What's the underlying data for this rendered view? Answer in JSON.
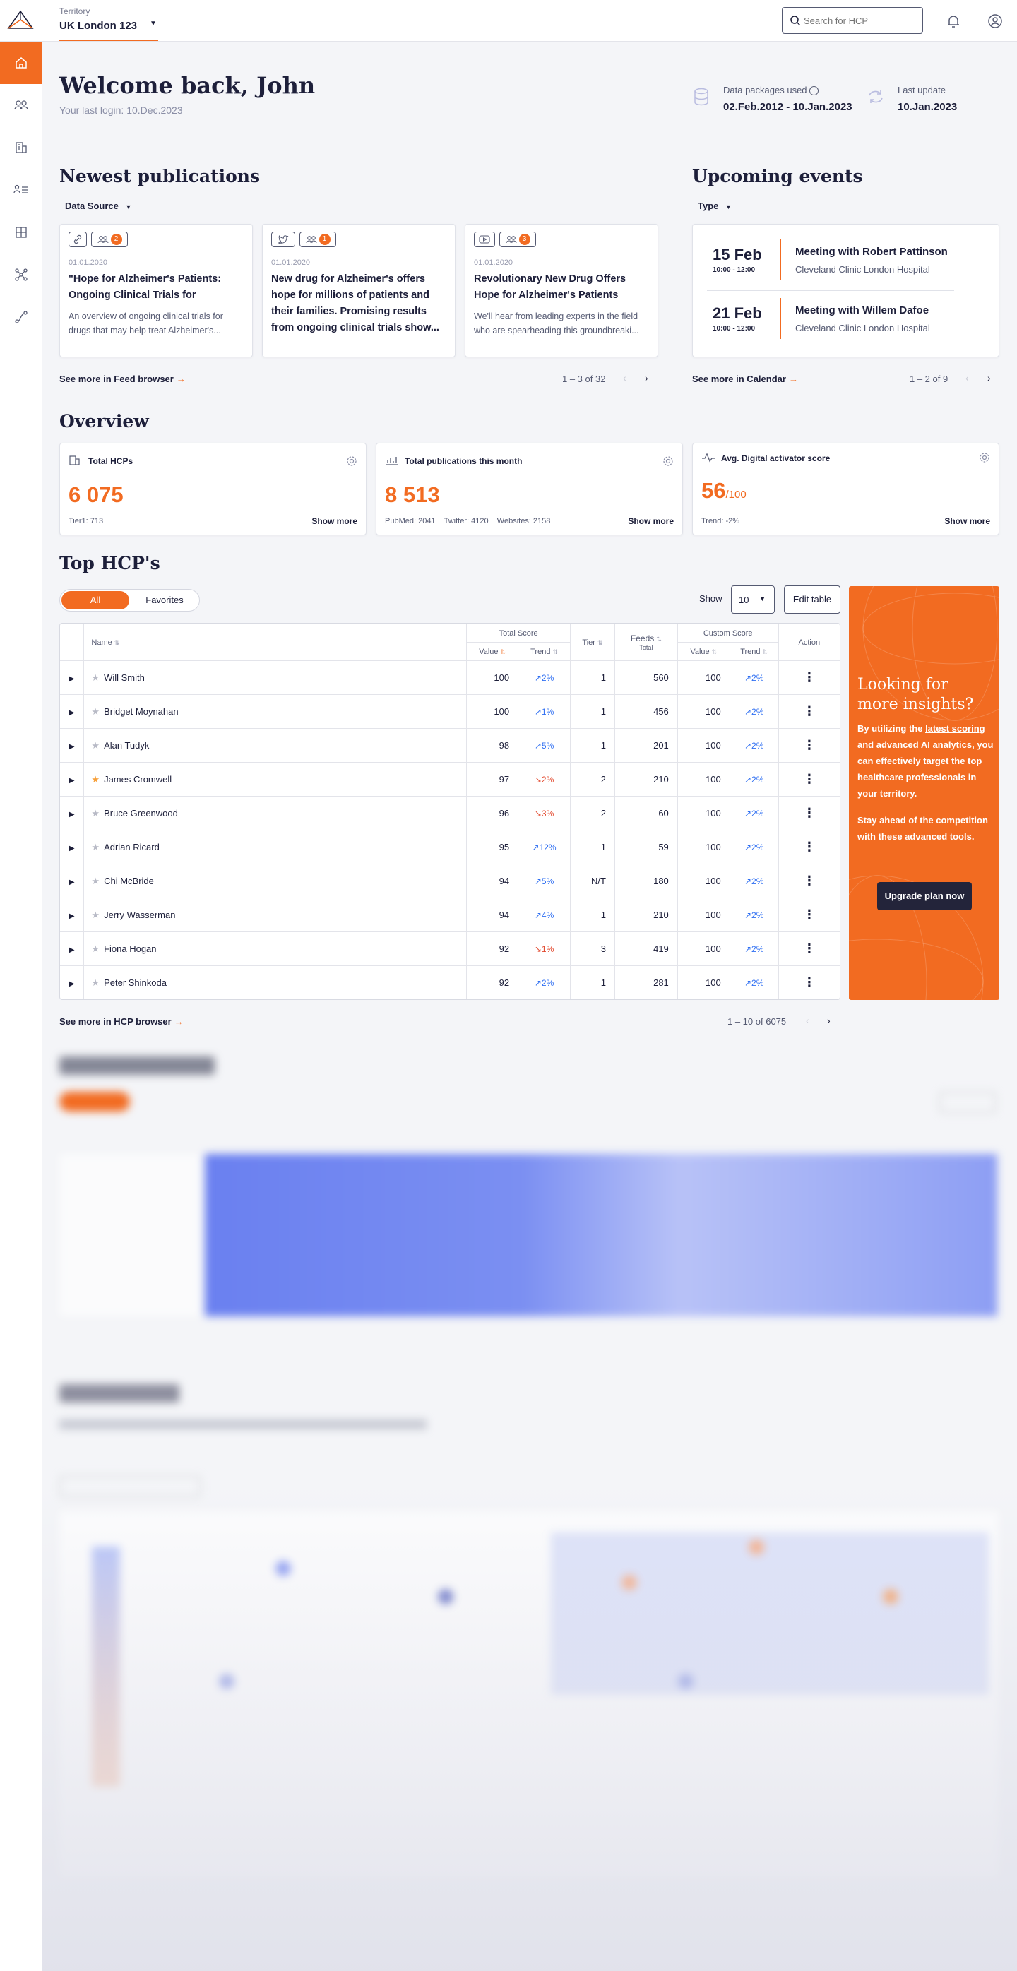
{
  "header": {
    "territory_label": "Territory",
    "territory_value": "UK London 123",
    "search_placeholder": "Search for HCP"
  },
  "welcome": {
    "title": "Welcome back, John",
    "last_login": "Your last login: 10.Dec.2023",
    "packages_label": "Data packages used",
    "packages_value": "02.Feb.2012 - 10.Jan.2023",
    "update_label": "Last update",
    "update_value": "10.Jan.2023"
  },
  "publications": {
    "title": "Newest publications",
    "filter": "Data Source",
    "items": [
      {
        "date": "01.01.2020",
        "count": "2",
        "title": "\"Hope for Alzheimer's Patients: Ongoing Clinical Trials for Promising...",
        "body": "An overview of ongoing clinical trials for drugs that may help treat Alzheimer's..."
      },
      {
        "date": "01.01.2020",
        "count": "1",
        "title": "New drug for Alzheimer's offers hope for millions of patients and their families. Promising results from ongoing clinical trials show...",
        "body": ""
      },
      {
        "date": "01.01.2020",
        "count": "3",
        "title": "Revolutionary New Drug Offers Hope for Alzheimer's Patients",
        "body": "We'll hear from leading experts in the field who are spearheading this groundbreaki..."
      }
    ],
    "see_more": "See more in Feed browser",
    "pager": "1 – 3 of 32"
  },
  "events": {
    "title": "Upcoming events",
    "filter": "Type",
    "items": [
      {
        "date": "15 Feb",
        "time": "10:00 - 12:00",
        "title": "Meeting with Robert Pattinson",
        "location": "Cleveland Clinic London Hospital"
      },
      {
        "date": "21 Feb",
        "time": "10:00 - 12:00",
        "title": "Meeting with Willem Dafoe",
        "location": "Cleveland Clinic London Hospital"
      }
    ],
    "see_more": "See more in Calendar",
    "pager": "1 – 2 of 9"
  },
  "overview": {
    "title": "Overview",
    "cards": [
      {
        "title": "Total HCPs",
        "value": "6 075",
        "unit": "",
        "detail": "Tier1: 713",
        "more": "Show more"
      },
      {
        "title": "Total publications this month",
        "value": "8 513",
        "unit": "",
        "detail": "PubMed: 2041    Twitter: 4120    Websites: 2158",
        "more": "Show more"
      },
      {
        "title": "Avg. Digital activator score",
        "value": "56",
        "unit": "/100",
        "detail": "Trend: -2%",
        "more": "Show more"
      }
    ]
  },
  "top_hcps": {
    "title": "Top HCP's",
    "tab_all": "All",
    "tab_favorites": "Favorites",
    "show_label": "Show",
    "show_value": "10",
    "edit_table": "Edit table",
    "columns": {
      "name": "Name",
      "total_score": "Total Score",
      "value": "Value",
      "trend": "Trend",
      "tier": "Tier",
      "feeds": "Feeds",
      "feeds_sub": "Total",
      "custom_score": "Custom Score",
      "action": "Action"
    },
    "rows": [
      {
        "name": "Will Smith",
        "fav": false,
        "value": "100",
        "trend": "2%",
        "dir": "up",
        "tier": "1",
        "feeds": "560",
        "cvalue": "100",
        "ctrend": "2%"
      },
      {
        "name": "Bridget Moynahan",
        "fav": false,
        "value": "100",
        "trend": "1%",
        "dir": "up",
        "tier": "1",
        "feeds": "456",
        "cvalue": "100",
        "ctrend": "2%"
      },
      {
        "name": "Alan Tudyk",
        "fav": false,
        "value": "98",
        "trend": "5%",
        "dir": "up",
        "tier": "1",
        "feeds": "201",
        "cvalue": "100",
        "ctrend": "2%"
      },
      {
        "name": "James Cromwell",
        "fav": true,
        "value": "97",
        "trend": "2%",
        "dir": "down",
        "tier": "2",
        "feeds": "210",
        "cvalue": "100",
        "ctrend": "2%"
      },
      {
        "name": "Bruce Greenwood",
        "fav": false,
        "value": "96",
        "trend": "3%",
        "dir": "down",
        "tier": "2",
        "feeds": "60",
        "cvalue": "100",
        "ctrend": "2%"
      },
      {
        "name": "Adrian Ricard",
        "fav": false,
        "value": "95",
        "trend": "12%",
        "dir": "up",
        "tier": "1",
        "feeds": "59",
        "cvalue": "100",
        "ctrend": "2%"
      },
      {
        "name": "Chi McBride",
        "fav": false,
        "value": "94",
        "trend": "5%",
        "dir": "up",
        "tier": "N/T",
        "feeds": "180",
        "cvalue": "100",
        "ctrend": "2%"
      },
      {
        "name": "Jerry Wasserman",
        "fav": false,
        "value": "94",
        "trend": "4%",
        "dir": "up",
        "tier": "1",
        "feeds": "210",
        "cvalue": "100",
        "ctrend": "2%"
      },
      {
        "name": "Fiona Hogan",
        "fav": false,
        "value": "92",
        "trend": "1%",
        "dir": "down",
        "tier": "3",
        "feeds": "419",
        "cvalue": "100",
        "ctrend": "2%"
      },
      {
        "name": "Peter Shinkoda",
        "fav": false,
        "value": "92",
        "trend": "2%",
        "dir": "up",
        "tier": "1",
        "feeds": "281",
        "cvalue": "100",
        "ctrend": "2%"
      }
    ],
    "see_more": "See more in HCP browser",
    "pager": "1 – 10 of 6075"
  },
  "promo": {
    "title": "Looking for more insights?",
    "p1_pre": "By utilizing the ",
    "p1_link": "latest scoring and advanced AI analytics,",
    "p1_post": " you can effectively target the top healthcare professionals in your territory.",
    "p2": "Stay ahead of the competition with these advanced tools.",
    "button": "Upgrade plan now"
  },
  "colors": {
    "accent": "#f26b21",
    "dark": "#23243a",
    "trend_up": "#2f6ff2",
    "trend_down": "#e2472c"
  }
}
